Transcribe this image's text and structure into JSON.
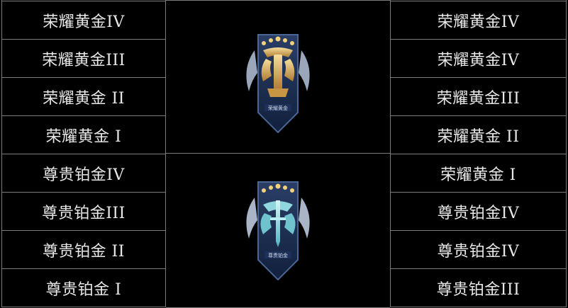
{
  "left_column": [
    "荣耀黄金IV",
    "荣耀黄金III",
    "荣耀黄金 II",
    "荣耀黄金 I",
    "尊贵铂金IV",
    "尊贵铂金III",
    "尊贵铂金 II",
    "尊贵铂金 I"
  ],
  "right_column": [
    "荣耀黄金IV",
    "荣耀黄金IV",
    "荣耀黄金III",
    "荣耀黄金 II",
    "荣耀黄金 I",
    "尊贵铂金IV",
    "尊贵铂金IV",
    "尊贵铂金III"
  ],
  "badges": {
    "gold": {
      "label": "荣耀黄金",
      "icon": "gold-rank-badge-icon",
      "accent": "#d8ae62"
    },
    "platinum": {
      "label": "尊贵铂金",
      "icon": "platinum-rank-badge-icon",
      "accent": "#7fd6e0"
    }
  }
}
